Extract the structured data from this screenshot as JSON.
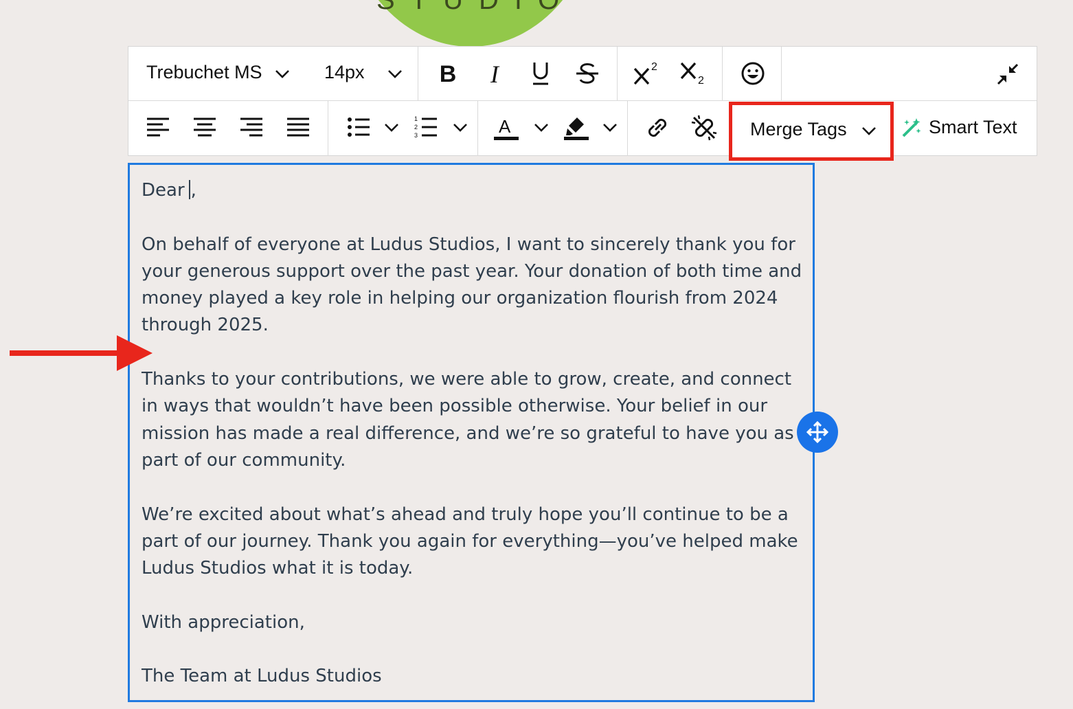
{
  "logo": {
    "text": "STUDIOS"
  },
  "toolbar": {
    "font_family": "Trebuchet MS",
    "font_size": "14px",
    "merge_tags_label": "Merge Tags",
    "smart_text_label": "Smart Text",
    "icons": [
      "bold-icon",
      "italic-icon",
      "underline-icon",
      "strikethrough-icon",
      "superscript-icon",
      "subscript-icon",
      "emoji-icon",
      "collapse-icon",
      "align-left-icon",
      "align-center-icon",
      "align-right-icon",
      "align-justify-icon",
      "bullet-list-icon",
      "numbered-list-icon",
      "text-color-icon",
      "highlight-icon",
      "link-icon",
      "unlink-icon",
      "magic-wand-icon"
    ]
  },
  "editor": {
    "greeting": "Dear",
    "greeting_suffix": ",",
    "paragraphs": [
      "On behalf of everyone at Ludus Studios, I want to sincerely thank you for your generous support over the past year. Your donation of both time and money played a key role in helping our organization flourish from 2024 through 2025.",
      "Thanks to your contributions, we were able to grow, create, and connect in ways that wouldn’t have been possible otherwise. Your belief in our mission has made a real difference, and we’re so grateful to have you as part of our community.",
      "We’re excited about what’s ahead and truly hope you’ll continue to be a part of our journey. Thank you again for everything—you’ve helped make Ludus Studios what it is today.",
      "With appreciation,",
      "The Team at Ludus Studios"
    ]
  },
  "colors": {
    "background": "#efebe9",
    "accent_blue": "#1f7ae0",
    "highlight_red": "#e8261c",
    "logo_green": "#92c84a",
    "smart_text_green": "#2bbf8a",
    "body_text": "#2f3e4d"
  }
}
